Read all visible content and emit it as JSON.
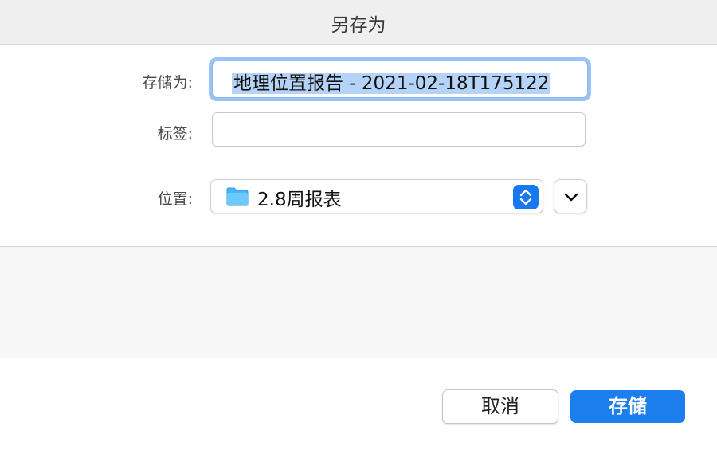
{
  "dialog": {
    "title": "另存为"
  },
  "form": {
    "save_as_label": "存储为:",
    "save_as_value": "地理位置报告 - 2021-02-18T175122",
    "tags_label": "标签:",
    "tags_value": "",
    "location_label": "位置:",
    "location_value": "2.8周报表"
  },
  "buttons": {
    "cancel_label": "取消",
    "save_label": "存储"
  },
  "icons": {
    "folder": "folder-icon",
    "stepper": "up-down-chevron-icon",
    "expand": "chevron-down-icon"
  },
  "colors": {
    "accent": "#1778f0",
    "save_button": "#1d7fee",
    "focus_ring": "#9bc3f3",
    "selection": "#b5d3f6"
  }
}
